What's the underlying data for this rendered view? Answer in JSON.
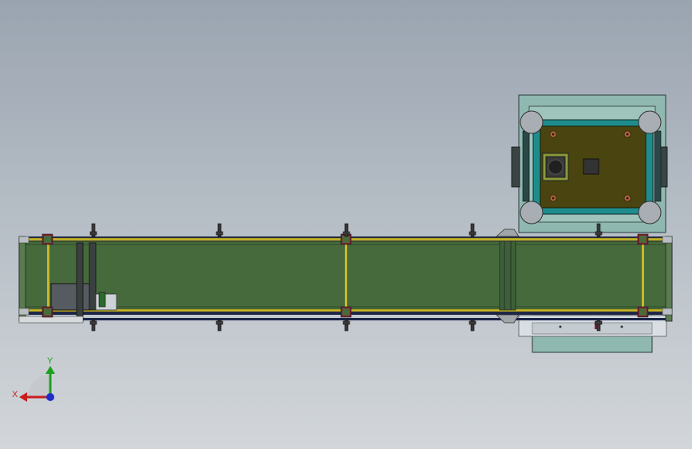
{
  "viewport": {
    "view": "top",
    "background_top": "#9aa4b0",
    "background_bottom": "#d2d6da"
  },
  "colors": {
    "belt": "#466a3c",
    "belt_dark": "#2f4a2a",
    "rail_yellow": "#c8b828",
    "frame_navy": "#1a2448",
    "bracket_maroon": "#7a2030",
    "cabinet_frame": "#8fb8b0",
    "plate_olive": "#4a4410",
    "plate_teal": "#1e8c8c",
    "wheel_grey": "#a8aeb4"
  },
  "triad": {
    "y_label": "Y",
    "x_label": "X",
    "y_color": "#1ea01e",
    "x_color": "#c81e1e",
    "z_color": "#1e2ec8"
  }
}
